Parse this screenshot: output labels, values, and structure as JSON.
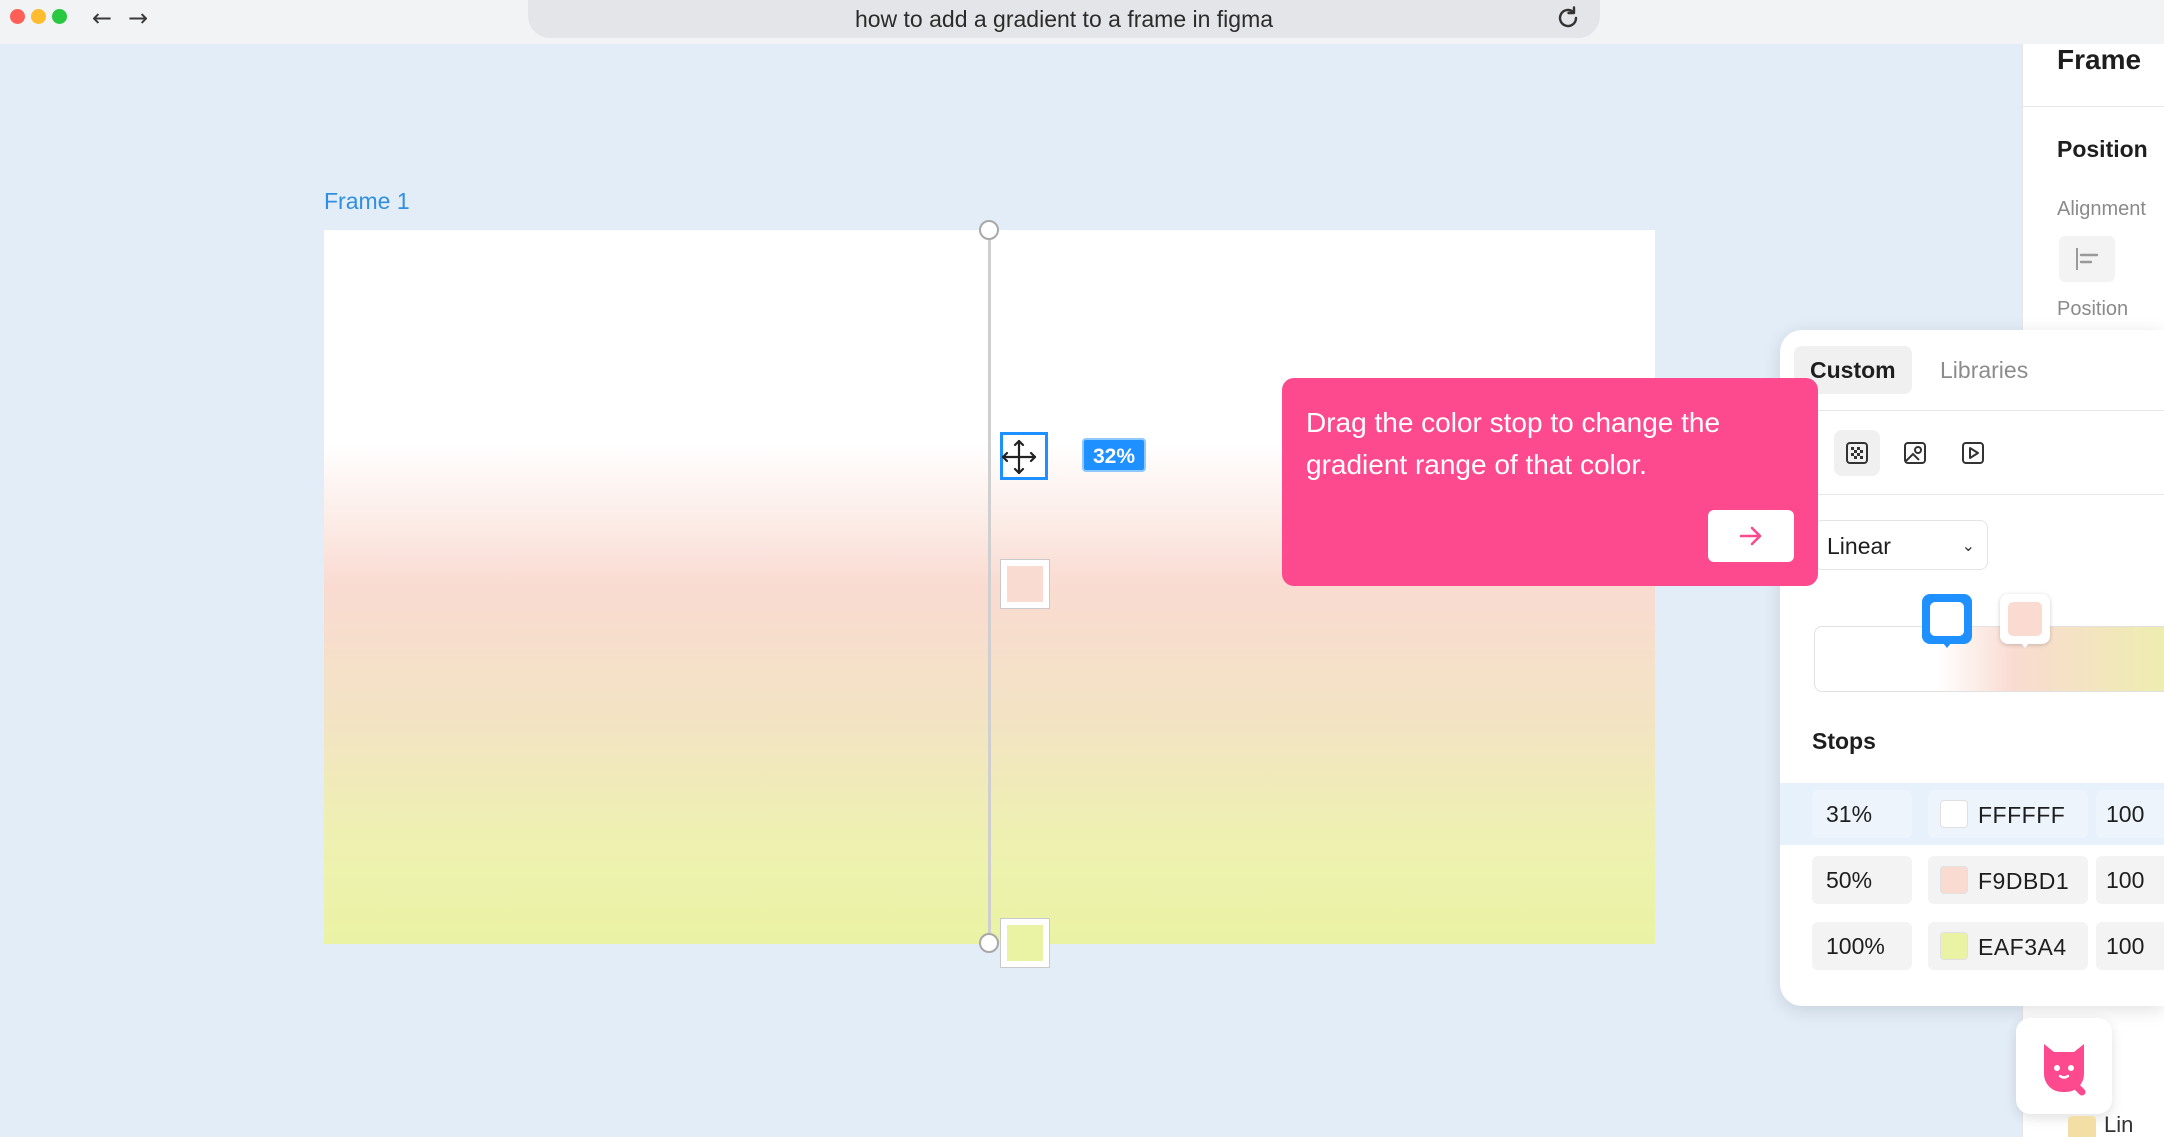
{
  "browser": {
    "url_text": "how to add a gradient to a frame in figma",
    "traffic_colors": [
      "#ff5f57",
      "#febc2e",
      "#28c840"
    ]
  },
  "canvas": {
    "frame_label": "Frame 1",
    "stop_position_badge": "32%",
    "stop_colors": [
      "#FFFFFF",
      "#F9DBD1",
      "#EAF3A4"
    ]
  },
  "tooltip": {
    "text": "Drag the color stop to change the gradient range of that color.",
    "accent": "#fd4a8f"
  },
  "right_panel": {
    "title": "Frame",
    "section": "Position",
    "alignment_label": "Alignment",
    "position_label": "Position"
  },
  "fill_popup": {
    "tabs": [
      {
        "label": "Custom",
        "active": true
      },
      {
        "label": "Libraries",
        "active": false
      }
    ],
    "fill_type_icons": [
      "solid-icon",
      "gradient-icon",
      "image-icon",
      "video-icon"
    ],
    "gradient_type": "Linear",
    "stops_title": "Stops",
    "stops": [
      {
        "position": "31%",
        "hex": "FFFFFF",
        "opacity": "100",
        "color": "#FFFFFF",
        "selected": true
      },
      {
        "position": "50%",
        "hex": "F9DBD1",
        "opacity": "100",
        "color": "#F9DBD1",
        "selected": false
      },
      {
        "position": "100%",
        "hex": "EAF3A4",
        "opacity": "100",
        "color": "#EAF3A4",
        "selected": false
      }
    ],
    "next_layer_label": "Lin"
  },
  "colors": {
    "selection_blue": "#1e90ff",
    "frame_label_blue": "#2f8fe0",
    "canvas_bg": "#e3edf8"
  }
}
